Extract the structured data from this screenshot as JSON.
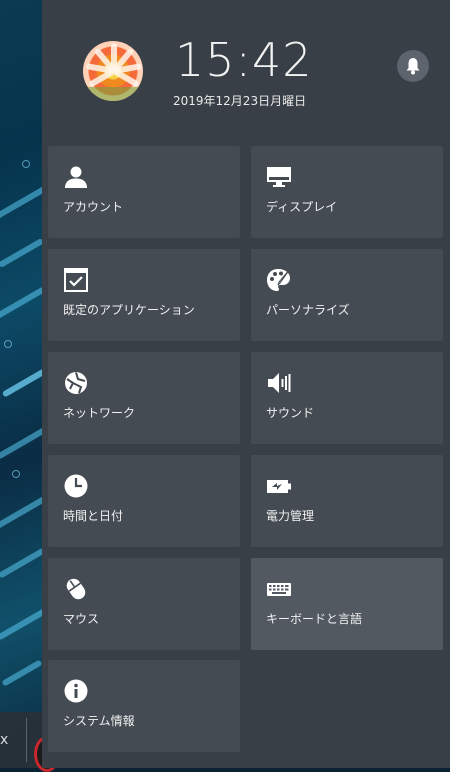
{
  "taskbar": {
    "fragment_text": "x"
  },
  "header": {
    "time": "15:42",
    "date": "2019年12月23日月曜日"
  },
  "tiles": [
    {
      "label": "アカウント",
      "icon": "person-icon"
    },
    {
      "label": "ディスプレイ",
      "icon": "monitor-icon"
    },
    {
      "label": "既定のアプリケーション",
      "icon": "default-apps-icon"
    },
    {
      "label": "パーソナライズ",
      "icon": "palette-icon"
    },
    {
      "label": "ネットワーク",
      "icon": "globe-icon"
    },
    {
      "label": "サウンド",
      "icon": "speaker-icon"
    },
    {
      "label": "時間と日付",
      "icon": "clock-icon"
    },
    {
      "label": "電力管理",
      "icon": "battery-icon"
    },
    {
      "label": "マウス",
      "icon": "mouse-icon"
    },
    {
      "label": "キーボードと言語",
      "icon": "keyboard-icon"
    },
    {
      "label": "システム情報",
      "icon": "info-icon"
    }
  ],
  "colors": {
    "panel_bg": "#393f46",
    "tile_bg": "#444b53",
    "tile_active_bg": "#525961",
    "text": "#f1f1f1"
  }
}
